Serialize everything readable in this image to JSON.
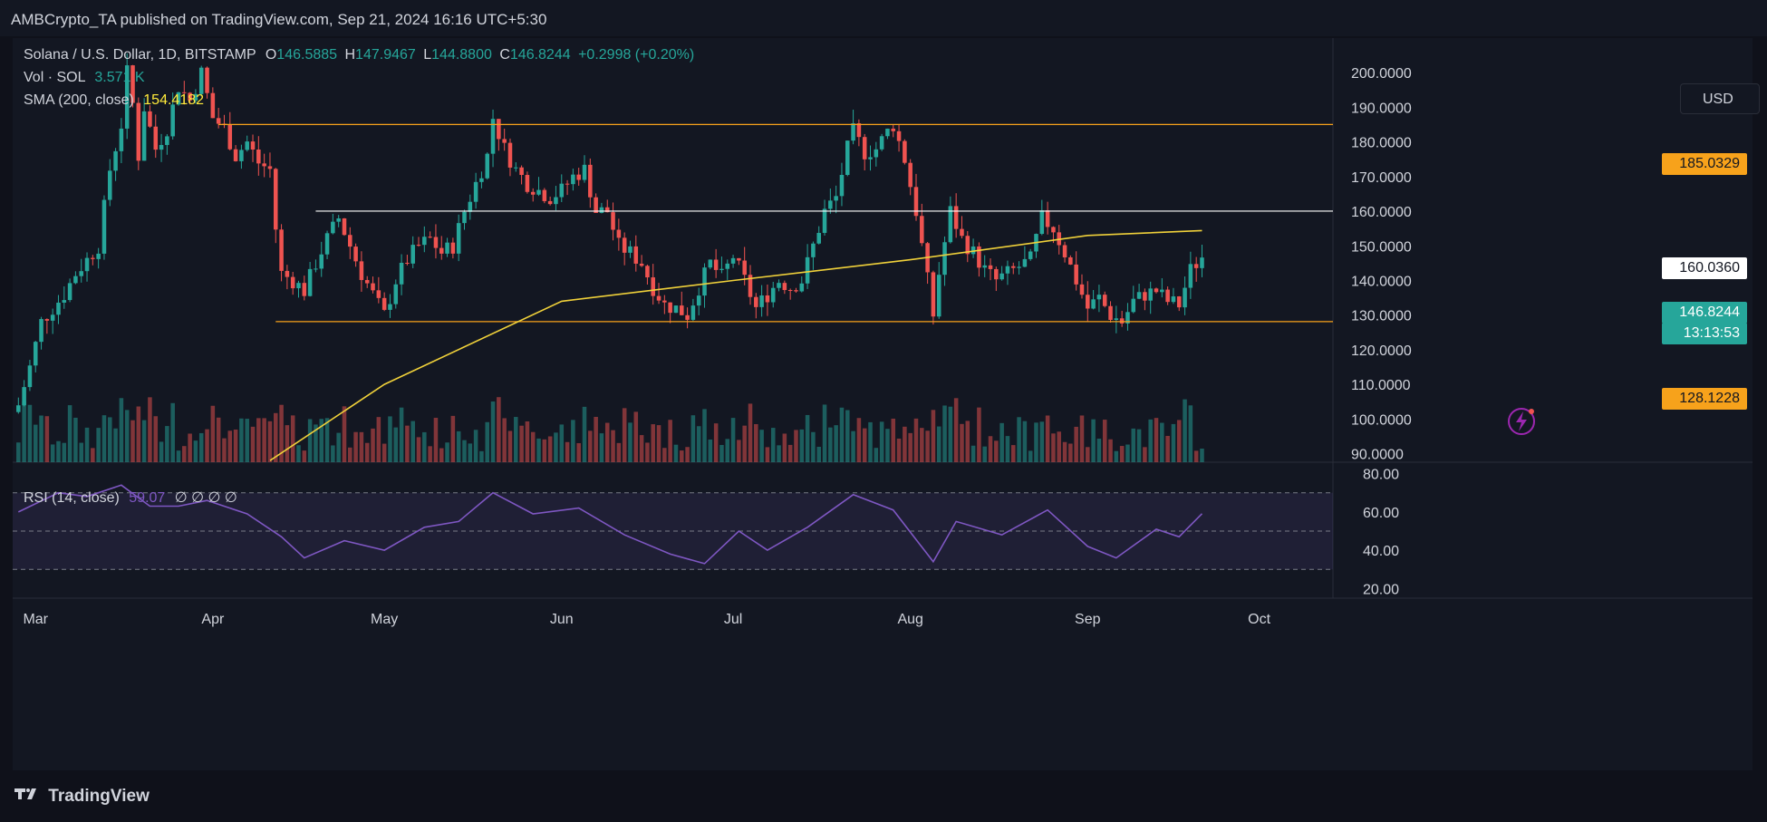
{
  "header": {
    "publisher": "AMBCrypto_TA published on TradingView.com, Sep 21, 2024 16:16 UTC+5:30"
  },
  "legend": {
    "symbol": "Solana / U.S. Dollar, 1D, BITSTAMP",
    "o_label": "O",
    "o": "146.5885",
    "h_label": "H",
    "h": "147.9467",
    "l_label": "L",
    "l": "144.8800",
    "c_label": "C",
    "c": "146.8244",
    "change": "+0.2998 (+0.20%)",
    "vol_label": "Vol · SOL",
    "vol": "3.571 K",
    "sma_label": "SMA (200, close)",
    "sma": "154.4182",
    "rsi_label": "RSI (14, close)",
    "rsi": "59.07",
    "rsi_extra": "∅ ∅ ∅ ∅"
  },
  "currency_button": "USD",
  "tags": {
    "price": "146.8244",
    "countdown": "13:13:53",
    "level_185": "185.0329",
    "level_160": "160.0360",
    "level_128": "128.1228"
  },
  "footer": {
    "brand": "TradingView"
  },
  "colors": {
    "up": "#26a69a",
    "down": "#ef5350",
    "sma": "#f0d13a",
    "orange_level": "#f7a21b",
    "white_level": "#ffffff",
    "rsi": "#7e57c2"
  },
  "chart_data": {
    "type": "candlestick",
    "x_axis": {
      "ticks": [
        "Mar",
        "Apr",
        "May",
        "Jun",
        "Jul",
        "Aug",
        "Sep",
        "Oct"
      ],
      "range": [
        "2024-02-26",
        "2024-10-12"
      ]
    },
    "price_axis": {
      "ticks": [
        "90.0000",
        "100.0000",
        "110.0000",
        "120.0000",
        "130.0000",
        "140.0000",
        "150.0000",
        "160.0000",
        "170.0000",
        "180.0000",
        "190.0000",
        "200.0000"
      ],
      "range": [
        87,
        210
      ]
    },
    "rsi_axis": {
      "ticks": [
        "20.00",
        "40.00",
        "60.00",
        "80.00"
      ],
      "range": [
        15,
        85
      ],
      "bands": [
        30,
        50,
        70
      ]
    },
    "horizontal_levels": [
      {
        "value": 185.0329,
        "color": "orange",
        "from": "2024-04-02"
      },
      {
        "value": 160.036,
        "color": "white",
        "from": "2024-04-19"
      },
      {
        "value": 128.1228,
        "color": "orange",
        "from": "2024-04-12"
      }
    ],
    "close_series": [
      [
        "2024-02-27",
        104
      ],
      [
        "2024-02-29",
        115
      ],
      [
        "2024-03-02",
        128
      ],
      [
        "2024-03-04",
        132
      ],
      [
        "2024-03-06",
        136
      ],
      [
        "2024-03-08",
        142
      ],
      [
        "2024-03-10",
        146
      ],
      [
        "2024-03-12",
        150
      ],
      [
        "2024-03-14",
        172
      ],
      [
        "2024-03-16",
        185
      ],
      [
        "2024-03-17",
        200
      ],
      [
        "2024-03-18",
        191
      ],
      [
        "2024-03-19",
        176
      ],
      [
        "2024-03-20",
        190
      ],
      [
        "2024-03-22",
        178
      ],
      [
        "2024-03-24",
        184
      ],
      [
        "2024-03-26",
        196
      ],
      [
        "2024-03-28",
        192
      ],
      [
        "2024-03-30",
        200
      ],
      [
        "2024-04-01",
        187
      ],
      [
        "2024-04-03",
        184
      ],
      [
        "2024-04-05",
        176
      ],
      [
        "2024-04-07",
        180
      ],
      [
        "2024-04-09",
        174
      ],
      [
        "2024-04-11",
        172
      ],
      [
        "2024-04-12",
        155
      ],
      [
        "2024-04-13",
        142
      ],
      [
        "2024-04-15",
        140
      ],
      [
        "2024-04-17",
        137
      ],
      [
        "2024-04-19",
        145
      ],
      [
        "2024-04-21",
        152
      ],
      [
        "2024-04-23",
        158
      ],
      [
        "2024-04-25",
        150
      ],
      [
        "2024-04-27",
        142
      ],
      [
        "2024-04-29",
        136
      ],
      [
        "2024-05-01",
        130
      ],
      [
        "2024-05-03",
        140
      ],
      [
        "2024-05-05",
        146
      ],
      [
        "2024-05-07",
        150
      ],
      [
        "2024-05-09",
        152
      ],
      [
        "2024-05-11",
        148
      ],
      [
        "2024-05-13",
        150
      ],
      [
        "2024-05-15",
        160
      ],
      [
        "2024-05-17",
        168
      ],
      [
        "2024-05-19",
        176
      ],
      [
        "2024-05-20",
        187
      ],
      [
        "2024-05-22",
        178
      ],
      [
        "2024-05-24",
        172
      ],
      [
        "2024-05-26",
        168
      ],
      [
        "2024-05-28",
        166
      ],
      [
        "2024-05-30",
        164
      ],
      [
        "2024-06-01",
        166
      ],
      [
        "2024-06-03",
        170
      ],
      [
        "2024-06-05",
        172
      ],
      [
        "2024-06-07",
        160
      ],
      [
        "2024-06-09",
        160
      ],
      [
        "2024-06-11",
        150
      ],
      [
        "2024-06-13",
        148
      ],
      [
        "2024-06-15",
        145
      ],
      [
        "2024-06-17",
        138
      ],
      [
        "2024-06-19",
        133
      ],
      [
        "2024-06-21",
        132
      ],
      [
        "2024-06-23",
        130
      ],
      [
        "2024-06-25",
        138
      ],
      [
        "2024-06-27",
        145
      ],
      [
        "2024-06-29",
        141
      ],
      [
        "2024-07-01",
        147
      ],
      [
        "2024-07-03",
        140
      ],
      [
        "2024-07-05",
        132
      ],
      [
        "2024-07-07",
        136
      ],
      [
        "2024-07-09",
        140
      ],
      [
        "2024-07-11",
        138
      ],
      [
        "2024-07-13",
        140
      ],
      [
        "2024-07-15",
        150
      ],
      [
        "2024-07-17",
        160
      ],
      [
        "2024-07-19",
        164
      ],
      [
        "2024-07-21",
        178
      ],
      [
        "2024-07-22",
        183
      ],
      [
        "2024-07-24",
        177
      ],
      [
        "2024-07-26",
        178
      ],
      [
        "2024-07-28",
        183
      ],
      [
        "2024-07-29",
        185
      ],
      [
        "2024-07-31",
        175
      ],
      [
        "2024-08-02",
        160
      ],
      [
        "2024-08-04",
        140
      ],
      [
        "2024-08-05",
        130
      ],
      [
        "2024-08-06",
        142
      ],
      [
        "2024-08-08",
        160
      ],
      [
        "2024-08-10",
        152
      ],
      [
        "2024-08-12",
        148
      ],
      [
        "2024-08-14",
        143
      ],
      [
        "2024-08-16",
        140
      ],
      [
        "2024-08-18",
        142
      ],
      [
        "2024-08-20",
        144
      ],
      [
        "2024-08-22",
        146
      ],
      [
        "2024-08-24",
        158
      ],
      [
        "2024-08-26",
        155
      ],
      [
        "2024-08-28",
        148
      ],
      [
        "2024-08-30",
        140
      ],
      [
        "2024-09-01",
        132
      ],
      [
        "2024-09-03",
        135
      ],
      [
        "2024-09-05",
        130
      ],
      [
        "2024-09-07",
        128
      ],
      [
        "2024-09-09",
        134
      ],
      [
        "2024-09-11",
        136
      ],
      [
        "2024-09-13",
        137
      ],
      [
        "2024-09-15",
        134
      ],
      [
        "2024-09-17",
        133
      ],
      [
        "2024-09-19",
        143
      ],
      [
        "2024-09-21",
        146.8244
      ]
    ],
    "sma_series": [
      [
        "2024-04-11",
        88
      ],
      [
        "2024-05-01",
        110
      ],
      [
        "2024-06-01",
        134
      ],
      [
        "2024-07-01",
        140
      ],
      [
        "2024-08-01",
        146
      ],
      [
        "2024-09-01",
        153
      ],
      [
        "2024-09-21",
        154.4182
      ]
    ],
    "rsi_series": [
      [
        "2024-02-27",
        60
      ],
      [
        "2024-03-05",
        70
      ],
      [
        "2024-03-10",
        68
      ],
      [
        "2024-03-16",
        74
      ],
      [
        "2024-03-21",
        63
      ],
      [
        "2024-03-26",
        63
      ],
      [
        "2024-03-31",
        66
      ],
      [
        "2024-04-07",
        59
      ],
      [
        "2024-04-13",
        47
      ],
      [
        "2024-04-17",
        36
      ],
      [
        "2024-04-24",
        45
      ],
      [
        "2024-05-01",
        40
      ],
      [
        "2024-05-08",
        52
      ],
      [
        "2024-05-14",
        55
      ],
      [
        "2024-05-20",
        70
      ],
      [
        "2024-05-27",
        59
      ],
      [
        "2024-06-04",
        62
      ],
      [
        "2024-06-12",
        48
      ],
      [
        "2024-06-20",
        38
      ],
      [
        "2024-06-26",
        33
      ],
      [
        "2024-07-02",
        50
      ],
      [
        "2024-07-07",
        40
      ],
      [
        "2024-07-14",
        52
      ],
      [
        "2024-07-22",
        69
      ],
      [
        "2024-07-29",
        61
      ],
      [
        "2024-08-05",
        34
      ],
      [
        "2024-08-09",
        55
      ],
      [
        "2024-08-17",
        48
      ],
      [
        "2024-08-25",
        61
      ],
      [
        "2024-09-01",
        42
      ],
      [
        "2024-09-06",
        36
      ],
      [
        "2024-09-13",
        51
      ],
      [
        "2024-09-17",
        47
      ],
      [
        "2024-09-21",
        59.07
      ]
    ]
  }
}
